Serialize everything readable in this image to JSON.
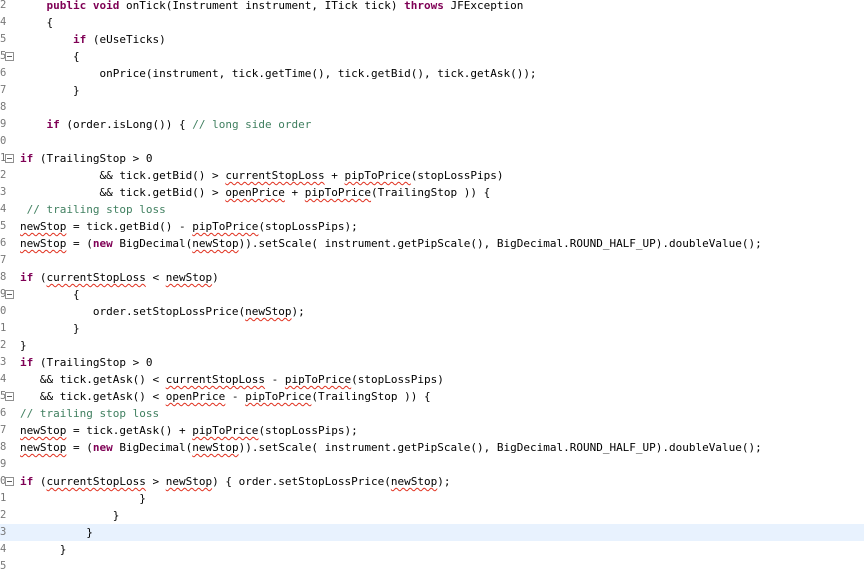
{
  "editor": {
    "line_numbers": [
      "2",
      "4",
      "5",
      "5",
      "6",
      "7",
      "8",
      "9",
      "0",
      "1",
      "2",
      "3",
      "4",
      "5",
      "6",
      "7",
      "8",
      "9",
      "0",
      "1",
      "2",
      "3",
      "4",
      "5",
      "6",
      "7",
      "8",
      "9",
      "0",
      "1",
      "2",
      "3",
      "4",
      "5"
    ],
    "lines": [
      [
        {
          "t": "    "
        },
        {
          "t": "public",
          "c": "kw"
        },
        {
          "t": " "
        },
        {
          "t": "void",
          "c": "kw"
        },
        {
          "t": " onTick(Instrument instrument, ITick tick) "
        },
        {
          "t": "throws",
          "c": "kw"
        },
        {
          "t": " JFException"
        }
      ],
      [
        {
          "t": "    {"
        }
      ],
      [
        {
          "t": "        "
        },
        {
          "t": "if",
          "c": "kw"
        },
        {
          "t": " (eUseTicks)"
        }
      ],
      [
        {
          "t": "        {"
        }
      ],
      [
        {
          "t": "            onPrice(instrument, tick.getTime(), tick.getBid(), tick.getAsk());"
        }
      ],
      [
        {
          "t": "        }"
        }
      ],
      [
        {
          "t": ""
        }
      ],
      [
        {
          "t": "    "
        },
        {
          "t": "if",
          "c": "kw"
        },
        {
          "t": " (order.isLong()) { "
        },
        {
          "t": "// long side order",
          "c": "cm"
        }
      ],
      [
        {
          "t": ""
        }
      ],
      [
        {
          "t": "if",
          "c": "kw"
        },
        {
          "t": " (TrailingStop > 0"
        }
      ],
      [
        {
          "t": "            && tick.getBid() > "
        },
        {
          "t": "currentStopLoss",
          "c": "sq"
        },
        {
          "t": " + "
        },
        {
          "t": "pipToPrice",
          "c": "sq"
        },
        {
          "t": "(stopLossPips)"
        }
      ],
      [
        {
          "t": "            && tick.getBid() > "
        },
        {
          "t": "openPrice",
          "c": "sq"
        },
        {
          "t": " + "
        },
        {
          "t": "pipToPrice",
          "c": "sq"
        },
        {
          "t": "(TrailingStop )) {"
        }
      ],
      [
        {
          "t": " "
        },
        {
          "t": "// trailing stop loss",
          "c": "cm"
        }
      ],
      [
        {
          "t": "newStop",
          "c": "sq"
        },
        {
          "t": " = tick.getBid() - "
        },
        {
          "t": "pipToPrice",
          "c": "sq"
        },
        {
          "t": "(stopLossPips);"
        }
      ],
      [
        {
          "t": "newStop",
          "c": "sq"
        },
        {
          "t": " = ("
        },
        {
          "t": "new",
          "c": "kw"
        },
        {
          "t": " BigDecimal("
        },
        {
          "t": "newStop",
          "c": "sq"
        },
        {
          "t": ")).setScale( instrument.getPipScale(), BigDecimal.ROUND_HALF_UP).doubleValue();"
        }
      ],
      [
        {
          "t": ""
        }
      ],
      [
        {
          "t": "if",
          "c": "kw"
        },
        {
          "t": " ("
        },
        {
          "t": "currentStopLoss",
          "c": "sq"
        },
        {
          "t": " < "
        },
        {
          "t": "newStop",
          "c": "sq"
        },
        {
          "t": ")"
        }
      ],
      [
        {
          "t": "        {"
        }
      ],
      [
        {
          "t": "           order.setStopLossPrice("
        },
        {
          "t": "newStop",
          "c": "sq"
        },
        {
          "t": ");"
        }
      ],
      [
        {
          "t": "        }"
        }
      ],
      [
        {
          "t": "}"
        }
      ],
      [
        {
          "t": "if",
          "c": "kw"
        },
        {
          "t": " (TrailingStop > 0"
        }
      ],
      [
        {
          "t": "   && tick.getAsk() < "
        },
        {
          "t": "currentStopLoss",
          "c": "sq"
        },
        {
          "t": " - "
        },
        {
          "t": "pipToPrice",
          "c": "sq"
        },
        {
          "t": "(stopLossPips)"
        }
      ],
      [
        {
          "t": "   && tick.getAsk() < "
        },
        {
          "t": "openPrice",
          "c": "sq"
        },
        {
          "t": " - "
        },
        {
          "t": "pipToPrice",
          "c": "sq"
        },
        {
          "t": "(TrailingStop )) {"
        }
      ],
      [
        {
          "t": "// trailing stop loss",
          "c": "cm"
        }
      ],
      [
        {
          "t": "newStop",
          "c": "sq"
        },
        {
          "t": " = tick.getAsk() + "
        },
        {
          "t": "pipToPrice",
          "c": "sq"
        },
        {
          "t": "(stopLossPips);"
        }
      ],
      [
        {
          "t": "newStop",
          "c": "sq"
        },
        {
          "t": " = ("
        },
        {
          "t": "new",
          "c": "kw"
        },
        {
          "t": " BigDecimal("
        },
        {
          "t": "newStop",
          "c": "sq"
        },
        {
          "t": ")).setScale( instrument.getPipScale(), BigDecimal.ROUND_HALF_UP).doubleValue();"
        }
      ],
      [
        {
          "t": ""
        }
      ],
      [
        {
          "t": "if",
          "c": "kw"
        },
        {
          "t": " ("
        },
        {
          "t": "currentStopLoss",
          "c": "sq"
        },
        {
          "t": " > "
        },
        {
          "t": "newStop",
          "c": "sq"
        },
        {
          "t": ") { order.setStopLossPrice("
        },
        {
          "t": "newStop",
          "c": "sq"
        },
        {
          "t": ");"
        }
      ],
      [
        {
          "t": "                  }"
        }
      ],
      [
        {
          "t": "              }"
        }
      ],
      [
        {
          "t": "          }"
        }
      ],
      [
        {
          "t": "      }"
        }
      ],
      [
        {
          "t": ""
        }
      ]
    ],
    "fold_markers": [
      3,
      9,
      17,
      23,
      28
    ],
    "current_line": 31,
    "colors": {
      "keyword": "#7f0055",
      "comment": "#3f7f5f",
      "squiggle": "#e0301e",
      "current_line_bg": "#e8f2fe",
      "line_number": "#787878"
    }
  }
}
